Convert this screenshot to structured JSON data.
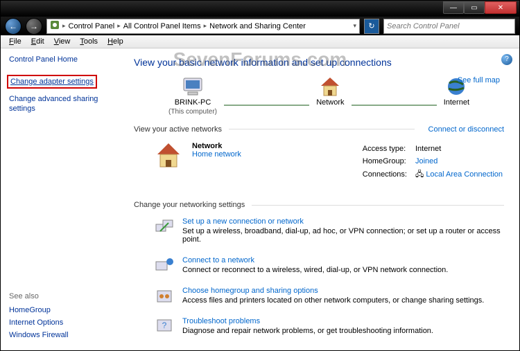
{
  "titlebar": {
    "min": "—",
    "max": "▭",
    "close": "✕"
  },
  "nav": {
    "crumbs": [
      "Control Panel",
      "All Control Panel Items",
      "Network and Sharing Center"
    ],
    "search_placeholder": "Search Control Panel"
  },
  "menu": {
    "file": "File",
    "edit": "Edit",
    "view": "View",
    "tools": "Tools",
    "help": "Help"
  },
  "watermark": "SevenForums.com",
  "sidebar": {
    "home": "Control Panel Home",
    "adapter": "Change adapter settings",
    "advanced": "Change advanced sharing settings",
    "seealso_hdr": "See also",
    "seealso": [
      "HomeGroup",
      "Internet Options",
      "Windows Firewall"
    ]
  },
  "main": {
    "heading": "View your basic network information and set up connections",
    "see_full_map": "See full map",
    "nodes": {
      "pc": "BRINK-PC",
      "pc_sub": "(This computer)",
      "network": "Network",
      "internet": "Internet"
    },
    "active_hdr": "View your active networks",
    "connect_link": "Connect or disconnect",
    "active": {
      "name": "Network",
      "type_link": "Home network",
      "access_label": "Access type:",
      "access_value": "Internet",
      "homegroup_label": "HomeGroup:",
      "homegroup_value": "Joined",
      "conn_label": "Connections:",
      "conn_value": "Local Area Connection"
    },
    "change_hdr": "Change your networking settings",
    "tasks": [
      {
        "title": "Set up a new connection or network",
        "desc": "Set up a wireless, broadband, dial-up, ad hoc, or VPN connection; or set up a router or access point."
      },
      {
        "title": "Connect to a network",
        "desc": "Connect or reconnect to a wireless, wired, dial-up, or VPN network connection."
      },
      {
        "title": "Choose homegroup and sharing options",
        "desc": "Access files and printers located on other network computers, or change sharing settings."
      },
      {
        "title": "Troubleshoot problems",
        "desc": "Diagnose and repair network problems, or get troubleshooting information."
      }
    ]
  }
}
